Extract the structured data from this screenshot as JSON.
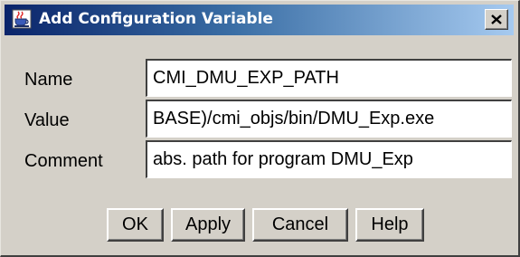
{
  "window": {
    "title": "Add Configuration Variable",
    "icon": "java-cup-icon",
    "close_label": "close-icon"
  },
  "form": {
    "name_label": "Name",
    "name_value": "CMI_DMU_EXP_PATH",
    "value_label": "Value",
    "value_value": "BASE)/cmi_objs/bin/DMU_Exp.exe",
    "comment_label": "Comment",
    "comment_value": "abs. path for program DMU_Exp"
  },
  "buttons": {
    "ok": "OK",
    "apply": "Apply",
    "cancel": "Cancel",
    "help": "Help"
  },
  "colors": {
    "titlebar_start": "#0a246a",
    "titlebar_end": "#a6caf0",
    "dialog_bg": "#d4d0c8"
  }
}
